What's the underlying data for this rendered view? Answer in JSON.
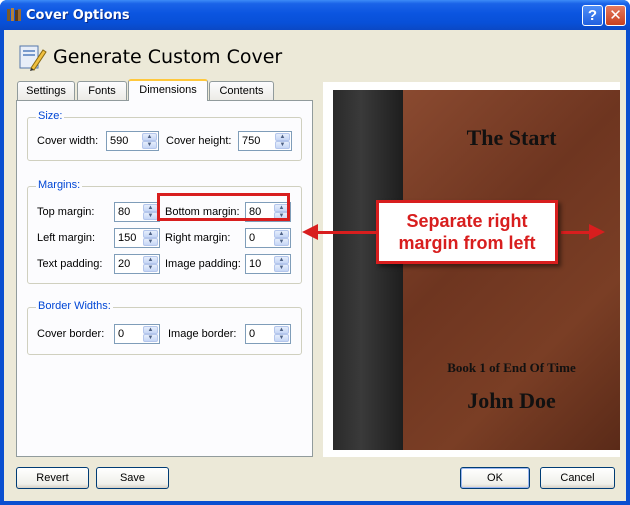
{
  "window": {
    "title": "Cover Options"
  },
  "titlebar_buttons": {
    "help": "?",
    "close": "✕"
  },
  "header": {
    "title": "Generate Custom Cover"
  },
  "tabs": [
    {
      "label": "Settings",
      "active": false
    },
    {
      "label": "Fonts",
      "active": false
    },
    {
      "label": "Dimensions",
      "active": true
    },
    {
      "label": "Contents",
      "active": false
    }
  ],
  "size": {
    "legend": "Size:",
    "cover_width_label": "Cover width:",
    "cover_width": "590",
    "cover_height_label": "Cover height:",
    "cover_height": "750"
  },
  "margins": {
    "legend": "Margins:",
    "top_label": "Top margin:",
    "top": "80",
    "bottom_label": "Bottom margin:",
    "bottom": "80",
    "left_label": "Left margin:",
    "left": "150",
    "right_label": "Right margin:",
    "right": "0",
    "text_padding_label": "Text padding:",
    "text_padding": "20",
    "image_padding_label": "Image padding:",
    "image_padding": "10"
  },
  "borders": {
    "legend": "Border Widths:",
    "cover_border_label": "Cover border:",
    "cover_border": "0",
    "image_border_label": "Image border:",
    "image_border": "0"
  },
  "preview": {
    "title": "The Start",
    "subtitle": "Book 1 of End Of Time",
    "author": "John Doe"
  },
  "annotation": {
    "line1": "Separate right",
    "line2": "margin from left"
  },
  "buttons": {
    "revert": "Revert",
    "save": "Save",
    "ok": "OK",
    "cancel": "Cancel"
  },
  "colors": {
    "accent": "#d81e1e",
    "titlebar": "#0b55e0",
    "group_legend": "#0046d5"
  }
}
